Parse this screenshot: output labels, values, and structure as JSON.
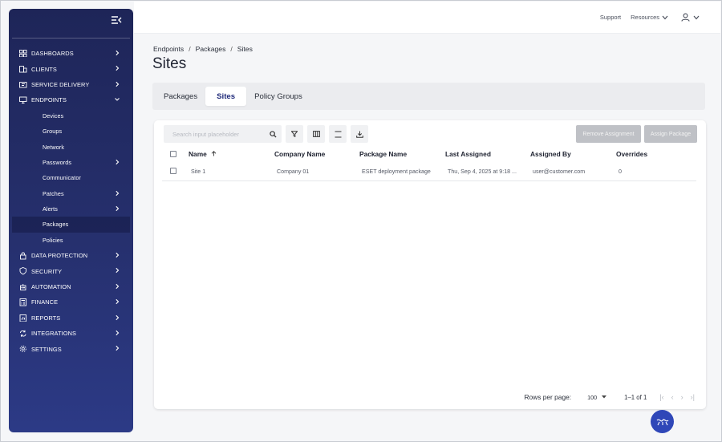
{
  "sidebar": {
    "items": [
      {
        "label": "DASHBOARDS",
        "icon": "grid-icon",
        "chevron": true
      },
      {
        "label": "CLIENTS",
        "icon": "building-icon",
        "chevron": true
      },
      {
        "label": "SERVICE DELIVERY",
        "icon": "ticket-icon",
        "chevron": true
      },
      {
        "label": "ENDPOINTS",
        "icon": "monitor-icon",
        "chevron": true
      },
      {
        "label": "Devices",
        "sub": true
      },
      {
        "label": "Groups",
        "sub": true
      },
      {
        "label": "Network",
        "sub": true
      },
      {
        "label": "Passwords",
        "sub": true,
        "chevron": true
      },
      {
        "label": "Communicator",
        "sub": true
      },
      {
        "label": "Patches",
        "sub": true,
        "chevron": true
      },
      {
        "label": "Alerts",
        "sub": true,
        "chevron": true
      },
      {
        "label": "Packages",
        "sub": true,
        "active": true
      },
      {
        "label": "Policies",
        "sub": true
      },
      {
        "label": "DATA PROTECTION",
        "icon": "lock-icon",
        "chevron": true
      },
      {
        "label": "SECURITY",
        "icon": "shield-icon",
        "chevron": true
      },
      {
        "label": "AUTOMATION",
        "icon": "robot-icon",
        "chevron": true
      },
      {
        "label": "FINANCE",
        "icon": "calculator-icon",
        "chevron": true
      },
      {
        "label": "REPORTS",
        "icon": "report-icon",
        "chevron": true
      },
      {
        "label": "INTEGRATIONS",
        "icon": "sync-icon",
        "chevron": true
      },
      {
        "label": "SETTINGS",
        "icon": "gear-icon",
        "chevron": true
      }
    ]
  },
  "topbar": {
    "support": "Support",
    "resources": "Resources"
  },
  "breadcrumb": [
    "Endpoints",
    "Packages",
    "Sites"
  ],
  "page_title": "Sites",
  "tabs": [
    {
      "label": "Packages"
    },
    {
      "label": "Sites",
      "active": true
    },
    {
      "label": "Policy Groups"
    }
  ],
  "toolbar": {
    "search_placeholder": "Search input placeholder",
    "remove_assignment": "Remove Assignment",
    "assign_package": "Assign Package"
  },
  "table": {
    "columns": [
      "Name",
      "Company Name",
      "Package Name",
      "Last Assigned",
      "Assigned By",
      "Overrides"
    ],
    "rows": [
      [
        "Site 1",
        "Company 01",
        "ESET deployment package",
        "Thu, Sep 4, 2025 at 9:18 ...",
        "user@customer.com",
        "0"
      ]
    ]
  },
  "footer": {
    "rows_per_page_label": "Rows per page:",
    "rows_per_page_value": "100",
    "range": "1–1 of 1"
  },
  "colors": {
    "sidebar": "#26306e",
    "accent": "#1f2a7a",
    "fab": "#2f47b8",
    "disabled_button": "#bfc1c6"
  }
}
